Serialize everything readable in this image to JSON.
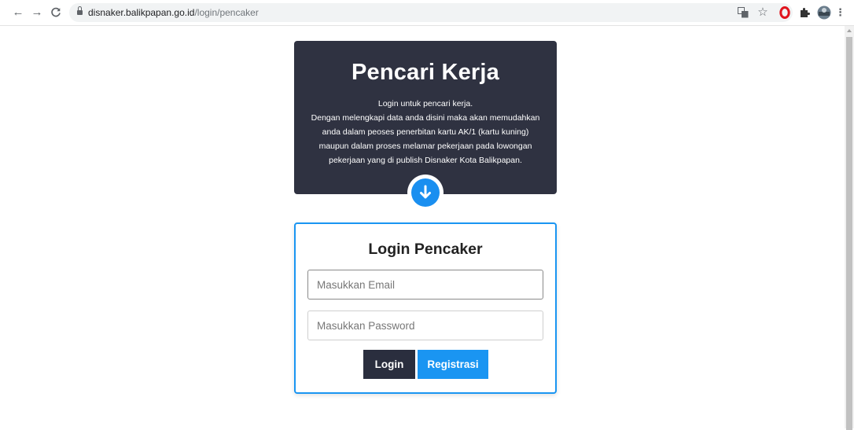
{
  "browser": {
    "url_host": "disnaker.balikpapan.go.id",
    "url_path": "/login/pencaker"
  },
  "hero": {
    "title": "Pencari Kerja",
    "description": "Login untuk pencari kerja.\nDengan melengkapi data anda disini maka akan memudahkan\nanda dalam peoses penerbitan kartu AK/1 (kartu kuning)\nmaupun dalam proses melamar pekerjaan pada lowongan\npekerjaan yang di publish Disnaker Kota Balikpapan."
  },
  "login": {
    "title": "Login Pencaker",
    "email_placeholder": "Masukkan Email",
    "email_value": "",
    "password_placeholder": "Masukkan Password",
    "password_value": "",
    "login_label": "Login",
    "register_label": "Registrasi"
  },
  "colors": {
    "hero_bg": "#2f3241",
    "accent": "#1a95f2",
    "login_button": "#2a2e3e"
  },
  "icons": {
    "hero_arrow": "arrow-down-circle-icon"
  }
}
